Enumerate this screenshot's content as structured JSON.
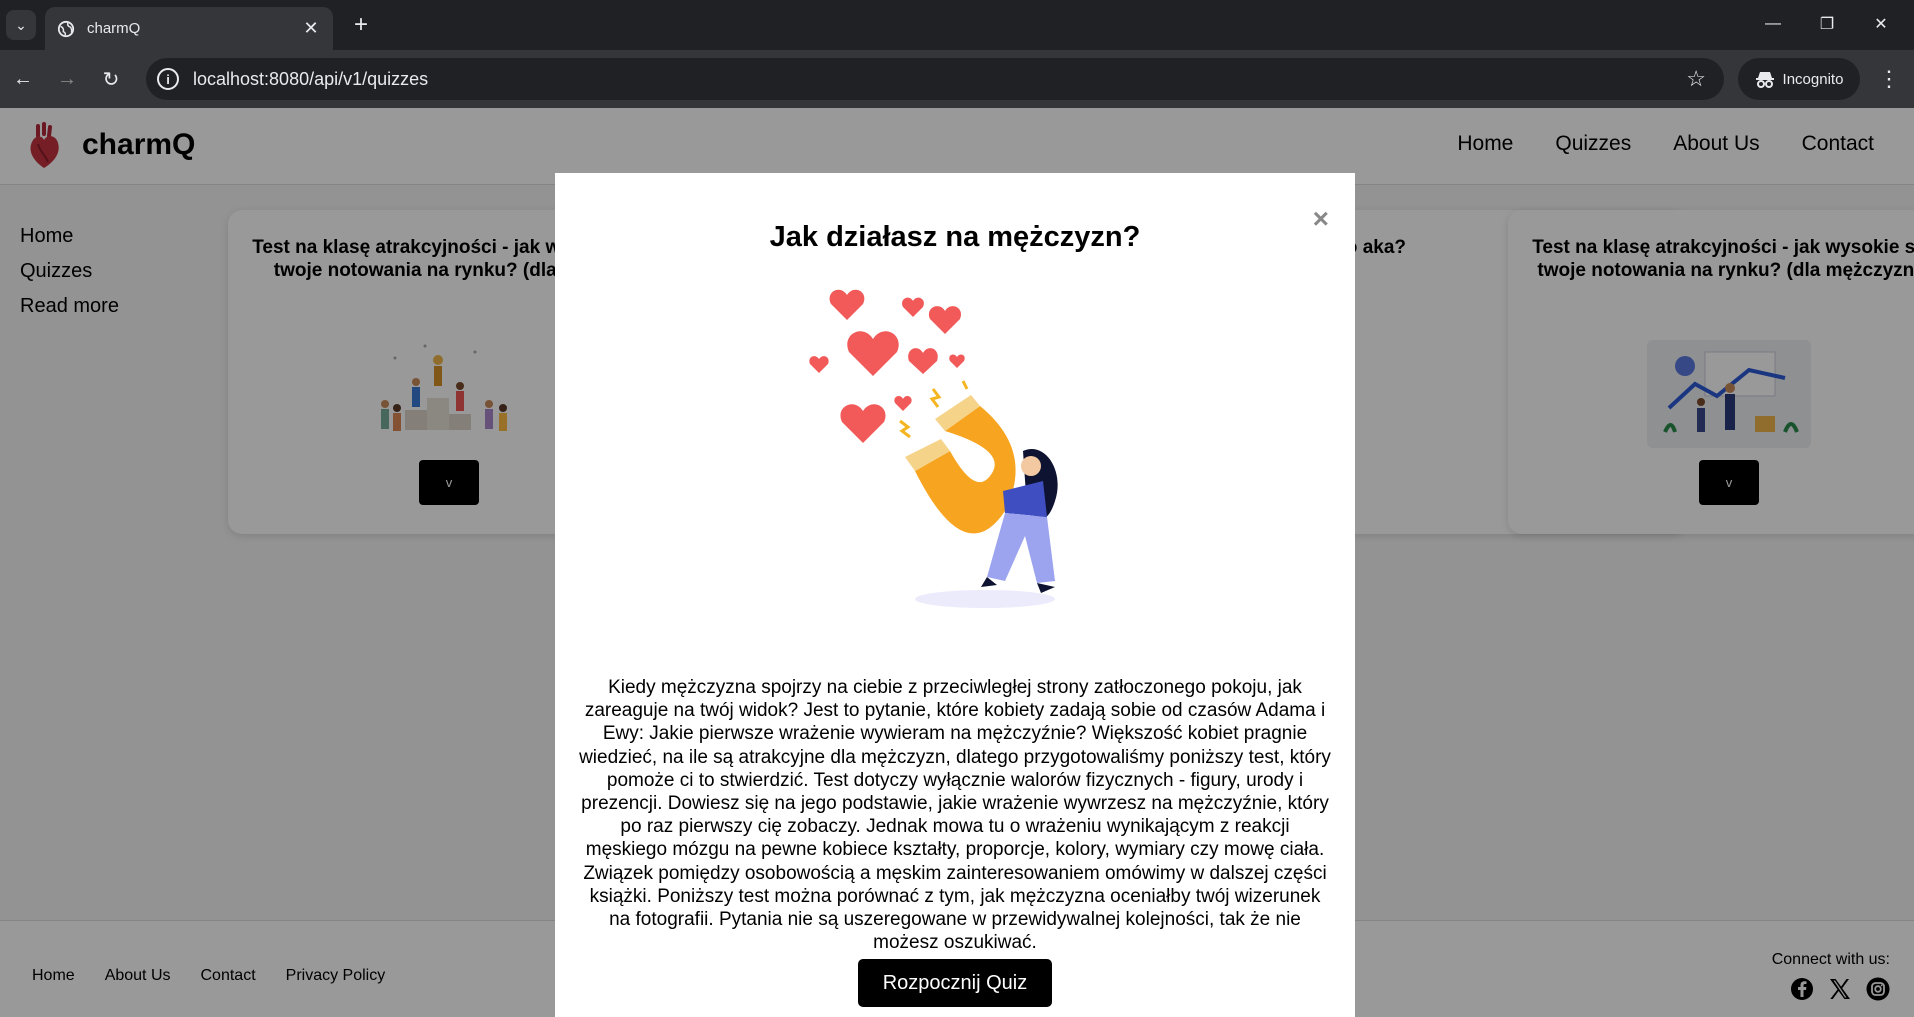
{
  "browser": {
    "tab_title": "charmQ",
    "url": "localhost:8080/api/v1/quizzes",
    "incognito_label": "Incognito"
  },
  "site": {
    "brand": "charmQ",
    "nav": [
      "Home",
      "Quizzes",
      "About Us",
      "Contact"
    ]
  },
  "sidebar": {
    "items": [
      "Home",
      "Quizzes",
      "Read more"
    ]
  },
  "cards": [
    {
      "title": "Test na klasę atrakcyjności - jak wysokie są twoje notowania na rynku? (dla kobiet)",
      "button": "v"
    },
    {
      "title": "Cię jako aka?",
      "button": "v"
    },
    {
      "title": "Test na klasę atrakcyjności - jak wysokie są twoje notowania na rynku? (dla mężczyzn)",
      "button": "v"
    }
  ],
  "footer": {
    "links": [
      "Home",
      "About Us",
      "Contact",
      "Privacy Policy"
    ],
    "connect": "Connect with us:",
    "social_icons": [
      "facebook-icon",
      "x-icon",
      "instagram-icon"
    ]
  },
  "modal": {
    "close": "×",
    "title": "Jak działasz na mężczyzn?",
    "description": "Kiedy mężczyzna spojrzy na ciebie z przeciwległej strony zatłoczonego pokoju, jak zareaguje na twój widok? Jest to pytanie, które kobiety zadają sobie od czasów Adama i Ewy: Jakie pierwsze wrażenie wywieram na mężczyźnie? Większość kobiet pragnie wiedzieć, na ile są atrakcyjne dla mężczyzn, dlatego przygotowaliśmy poniższy test, który pomoże ci to stwierdzić. Test dotyczy wyłącznie walorów fizycznych - figury, urody i prezencji. Dowiesz się na jego podstawie, jakie wrażenie wywrzesz na mężczyźnie, który po raz pierwszy cię zobaczy. Jednak mowa tu o wrażeniu wynikającym z reakcji męskiego mózgu na pewne kobiece kształty, proporcje, kolory, wymiary czy mowę ciała. Związek pomiędzy osobowością a męskim zainteresowaniem omówimy w dalszej części książki. Poniższy test można porównać z tym, jak mężczyzna oceniałby twój wizerunek na fotografii. Pytania nie są uszeregowane w przewidywalnej kolejności, tak że nie możesz oszukiwać.",
    "start_button": "Rozpocznij Quiz"
  },
  "colors": {
    "chrome_dark": "#202124",
    "chrome_mid": "#35363a",
    "heart": "#b5283a",
    "magnet": "#f7a520",
    "hearts": "#f25a5a",
    "figure": "#7a87d6"
  }
}
